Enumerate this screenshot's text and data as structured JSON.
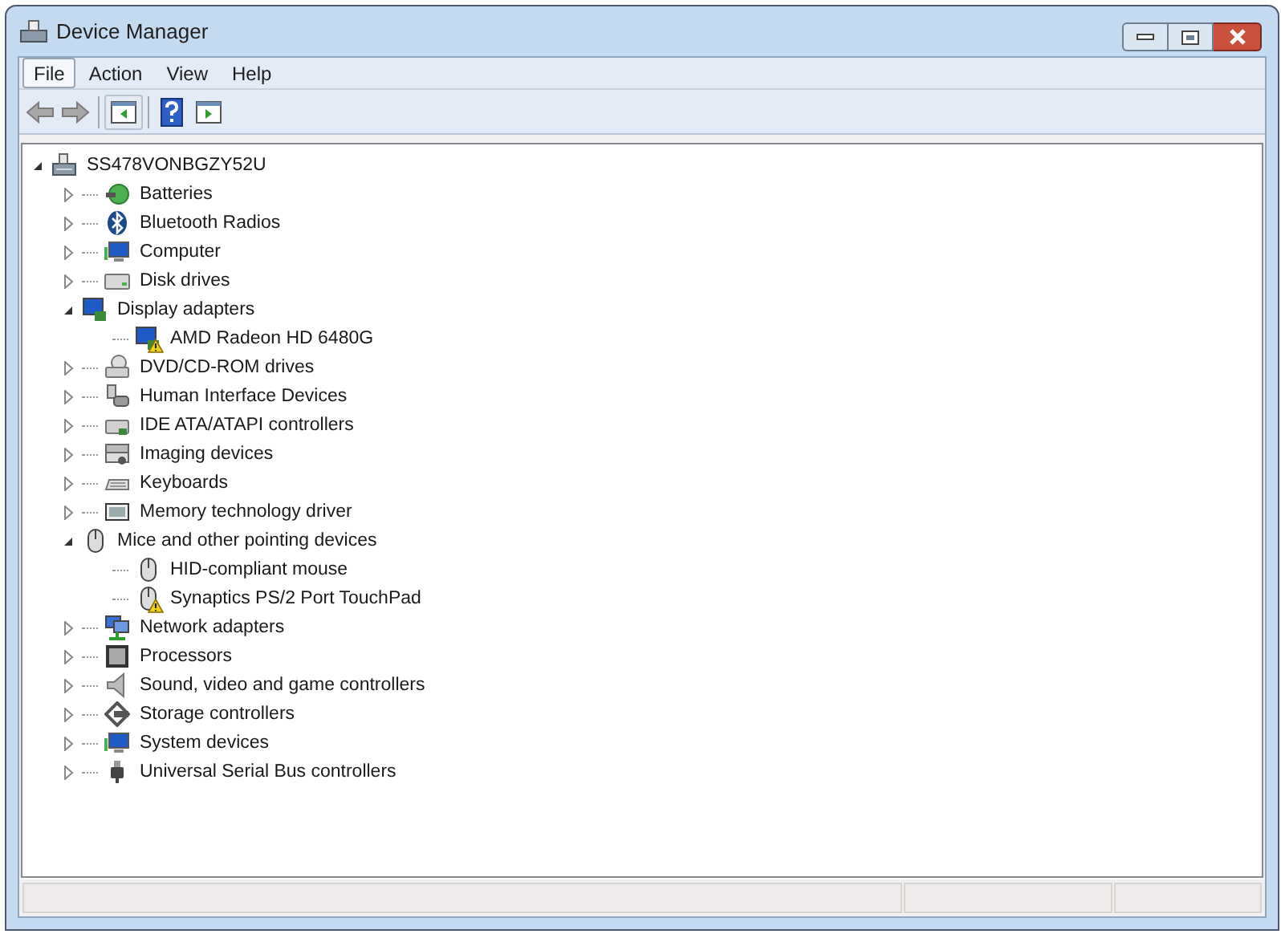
{
  "window": {
    "title": "Device Manager"
  },
  "menu": [
    {
      "label": "File",
      "selected": true
    },
    {
      "label": "Action",
      "selected": false
    },
    {
      "label": "View",
      "selected": false
    },
    {
      "label": "Help",
      "selected": false
    }
  ],
  "toolbar": [
    {
      "kind": "back",
      "disabled": true
    },
    {
      "kind": "forward",
      "disabled": true
    },
    {
      "kind": "separator"
    },
    {
      "kind": "console-tree",
      "disabled": false
    },
    {
      "kind": "separator"
    },
    {
      "kind": "help",
      "disabled": false
    },
    {
      "kind": "action-pane",
      "disabled": false
    }
  ],
  "tree": {
    "label": "SS478VONBGZY52U",
    "kind": "computer-root",
    "expanded": true,
    "children": [
      {
        "label": "Batteries",
        "kind": "battery",
        "expanded": false
      },
      {
        "label": "Bluetooth Radios",
        "kind": "bluetooth",
        "expanded": false
      },
      {
        "label": "Computer",
        "kind": "computer",
        "expanded": false
      },
      {
        "label": "Disk drives",
        "kind": "disk",
        "expanded": false
      },
      {
        "label": "Display adapters",
        "kind": "display",
        "expanded": true,
        "children": [
          {
            "label": "AMD Radeon HD 6480G",
            "kind": "display",
            "warning": true
          }
        ]
      },
      {
        "label": "DVD/CD-ROM drives",
        "kind": "dvd",
        "expanded": false
      },
      {
        "label": "Human Interface Devices",
        "kind": "hid",
        "expanded": false
      },
      {
        "label": "IDE ATA/ATAPI controllers",
        "kind": "ide",
        "expanded": false
      },
      {
        "label": "Imaging devices",
        "kind": "imaging",
        "expanded": false
      },
      {
        "label": "Keyboards",
        "kind": "keyboard",
        "expanded": false
      },
      {
        "label": "Memory technology driver",
        "kind": "memory",
        "expanded": false
      },
      {
        "label": "Mice and other pointing devices",
        "kind": "mouse",
        "expanded": true,
        "children": [
          {
            "label": "HID-compliant mouse",
            "kind": "mouse",
            "warning": false
          },
          {
            "label": "Synaptics PS/2 Port TouchPad",
            "kind": "mouse",
            "warning": true
          }
        ]
      },
      {
        "label": "Network adapters",
        "kind": "network",
        "expanded": false
      },
      {
        "label": "Processors",
        "kind": "processor",
        "expanded": false
      },
      {
        "label": "Sound, video and game controllers",
        "kind": "sound",
        "expanded": false
      },
      {
        "label": "Storage controllers",
        "kind": "storage",
        "expanded": false
      },
      {
        "label": "System devices",
        "kind": "computer",
        "expanded": false
      },
      {
        "label": "Universal Serial Bus controllers",
        "kind": "usb",
        "expanded": false
      }
    ]
  }
}
